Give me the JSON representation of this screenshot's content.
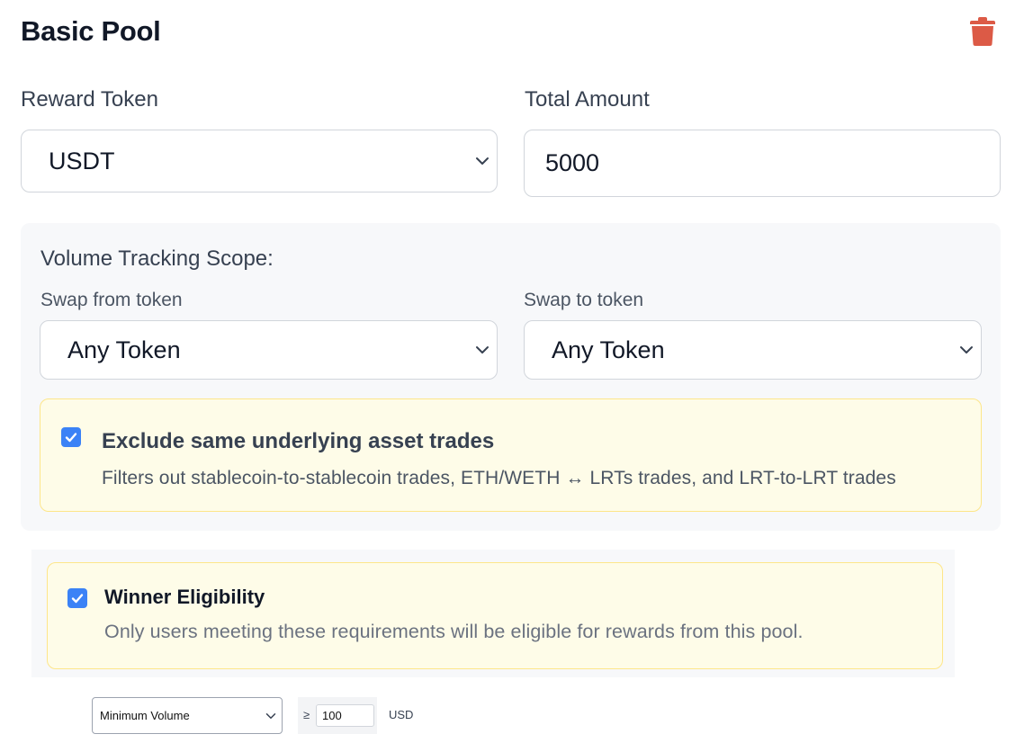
{
  "header": {
    "title": "Basic Pool",
    "delete_icon": "trash-icon",
    "delete_color": "#dc5a46"
  },
  "reward_token": {
    "label": "Reward Token",
    "selected": "USDT"
  },
  "total_amount": {
    "label": "Total Amount",
    "value": "5000"
  },
  "volume_scope": {
    "heading": "Volume Tracking Scope:",
    "swap_from": {
      "label": "Swap from token",
      "selected": "Any Token"
    },
    "swap_to": {
      "label": "Swap to token",
      "selected": "Any Token"
    },
    "exclude": {
      "checked": true,
      "title": "Exclude same underlying asset trades",
      "description": "Filters out stablecoin-to-stablecoin trades, ETH/WETH ↔ LRTs trades, and LRT-to-LRT trades"
    }
  },
  "eligibility": {
    "checked": true,
    "title": "Winner Eligibility",
    "description": "Only users meeting these requirements will be eligible for rewards from this pool."
  },
  "requirement": {
    "type_selected": "Minimum Volume",
    "operator": "≥",
    "value": "100",
    "unit": "USD"
  },
  "colors": {
    "accent": "#3b82f6",
    "note_bg": "#fefce8",
    "note_border": "#fde68a",
    "panel_bg": "#f7f8fa"
  }
}
